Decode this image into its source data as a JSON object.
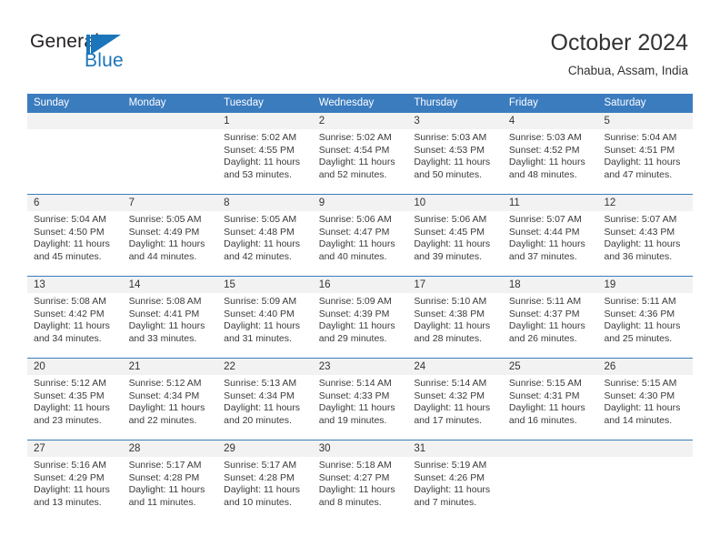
{
  "brand": {
    "name_top": "General",
    "name_bottom": "Blue",
    "accent_color": "#1b75bb"
  },
  "header": {
    "month_title": "October 2024",
    "location": "Chabua, Assam, India"
  },
  "theme": {
    "header_blue": "#3b7cbf",
    "daynum_band": "#f2f2f2",
    "text": "#333333"
  },
  "calendar": {
    "weekdays": [
      "Sunday",
      "Monday",
      "Tuesday",
      "Wednesday",
      "Thursday",
      "Friday",
      "Saturday"
    ],
    "labels": {
      "sunrise": "Sunrise:",
      "sunset": "Sunset:",
      "daylight": "Daylight:"
    },
    "weeks": [
      [
        {
          "day": "",
          "line1": "",
          "line2": "",
          "line3": "",
          "line4": ""
        },
        {
          "day": "",
          "line1": "",
          "line2": "",
          "line3": "",
          "line4": ""
        },
        {
          "day": "1",
          "line1": "Sunrise: 5:02 AM",
          "line2": "Sunset: 4:55 PM",
          "line3": "Daylight: 11 hours",
          "line4": "and 53 minutes."
        },
        {
          "day": "2",
          "line1": "Sunrise: 5:02 AM",
          "line2": "Sunset: 4:54 PM",
          "line3": "Daylight: 11 hours",
          "line4": "and 52 minutes."
        },
        {
          "day": "3",
          "line1": "Sunrise: 5:03 AM",
          "line2": "Sunset: 4:53 PM",
          "line3": "Daylight: 11 hours",
          "line4": "and 50 minutes."
        },
        {
          "day": "4",
          "line1": "Sunrise: 5:03 AM",
          "line2": "Sunset: 4:52 PM",
          "line3": "Daylight: 11 hours",
          "line4": "and 48 minutes."
        },
        {
          "day": "5",
          "line1": "Sunrise: 5:04 AM",
          "line2": "Sunset: 4:51 PM",
          "line3": "Daylight: 11 hours",
          "line4": "and 47 minutes."
        }
      ],
      [
        {
          "day": "6",
          "line1": "Sunrise: 5:04 AM",
          "line2": "Sunset: 4:50 PM",
          "line3": "Daylight: 11 hours",
          "line4": "and 45 minutes."
        },
        {
          "day": "7",
          "line1": "Sunrise: 5:05 AM",
          "line2": "Sunset: 4:49 PM",
          "line3": "Daylight: 11 hours",
          "line4": "and 44 minutes."
        },
        {
          "day": "8",
          "line1": "Sunrise: 5:05 AM",
          "line2": "Sunset: 4:48 PM",
          "line3": "Daylight: 11 hours",
          "line4": "and 42 minutes."
        },
        {
          "day": "9",
          "line1": "Sunrise: 5:06 AM",
          "line2": "Sunset: 4:47 PM",
          "line3": "Daylight: 11 hours",
          "line4": "and 40 minutes."
        },
        {
          "day": "10",
          "line1": "Sunrise: 5:06 AM",
          "line2": "Sunset: 4:45 PM",
          "line3": "Daylight: 11 hours",
          "line4": "and 39 minutes."
        },
        {
          "day": "11",
          "line1": "Sunrise: 5:07 AM",
          "line2": "Sunset: 4:44 PM",
          "line3": "Daylight: 11 hours",
          "line4": "and 37 minutes."
        },
        {
          "day": "12",
          "line1": "Sunrise: 5:07 AM",
          "line2": "Sunset: 4:43 PM",
          "line3": "Daylight: 11 hours",
          "line4": "and 36 minutes."
        }
      ],
      [
        {
          "day": "13",
          "line1": "Sunrise: 5:08 AM",
          "line2": "Sunset: 4:42 PM",
          "line3": "Daylight: 11 hours",
          "line4": "and 34 minutes."
        },
        {
          "day": "14",
          "line1": "Sunrise: 5:08 AM",
          "line2": "Sunset: 4:41 PM",
          "line3": "Daylight: 11 hours",
          "line4": "and 33 minutes."
        },
        {
          "day": "15",
          "line1": "Sunrise: 5:09 AM",
          "line2": "Sunset: 4:40 PM",
          "line3": "Daylight: 11 hours",
          "line4": "and 31 minutes."
        },
        {
          "day": "16",
          "line1": "Sunrise: 5:09 AM",
          "line2": "Sunset: 4:39 PM",
          "line3": "Daylight: 11 hours",
          "line4": "and 29 minutes."
        },
        {
          "day": "17",
          "line1": "Sunrise: 5:10 AM",
          "line2": "Sunset: 4:38 PM",
          "line3": "Daylight: 11 hours",
          "line4": "and 28 minutes."
        },
        {
          "day": "18",
          "line1": "Sunrise: 5:11 AM",
          "line2": "Sunset: 4:37 PM",
          "line3": "Daylight: 11 hours",
          "line4": "and 26 minutes."
        },
        {
          "day": "19",
          "line1": "Sunrise: 5:11 AM",
          "line2": "Sunset: 4:36 PM",
          "line3": "Daylight: 11 hours",
          "line4": "and 25 minutes."
        }
      ],
      [
        {
          "day": "20",
          "line1": "Sunrise: 5:12 AM",
          "line2": "Sunset: 4:35 PM",
          "line3": "Daylight: 11 hours",
          "line4": "and 23 minutes."
        },
        {
          "day": "21",
          "line1": "Sunrise: 5:12 AM",
          "line2": "Sunset: 4:34 PM",
          "line3": "Daylight: 11 hours",
          "line4": "and 22 minutes."
        },
        {
          "day": "22",
          "line1": "Sunrise: 5:13 AM",
          "line2": "Sunset: 4:34 PM",
          "line3": "Daylight: 11 hours",
          "line4": "and 20 minutes."
        },
        {
          "day": "23",
          "line1": "Sunrise: 5:14 AM",
          "line2": "Sunset: 4:33 PM",
          "line3": "Daylight: 11 hours",
          "line4": "and 19 minutes."
        },
        {
          "day": "24",
          "line1": "Sunrise: 5:14 AM",
          "line2": "Sunset: 4:32 PM",
          "line3": "Daylight: 11 hours",
          "line4": "and 17 minutes."
        },
        {
          "day": "25",
          "line1": "Sunrise: 5:15 AM",
          "line2": "Sunset: 4:31 PM",
          "line3": "Daylight: 11 hours",
          "line4": "and 16 minutes."
        },
        {
          "day": "26",
          "line1": "Sunrise: 5:15 AM",
          "line2": "Sunset: 4:30 PM",
          "line3": "Daylight: 11 hours",
          "line4": "and 14 minutes."
        }
      ],
      [
        {
          "day": "27",
          "line1": "Sunrise: 5:16 AM",
          "line2": "Sunset: 4:29 PM",
          "line3": "Daylight: 11 hours",
          "line4": "and 13 minutes."
        },
        {
          "day": "28",
          "line1": "Sunrise: 5:17 AM",
          "line2": "Sunset: 4:28 PM",
          "line3": "Daylight: 11 hours",
          "line4": "and 11 minutes."
        },
        {
          "day": "29",
          "line1": "Sunrise: 5:17 AM",
          "line2": "Sunset: 4:28 PM",
          "line3": "Daylight: 11 hours",
          "line4": "and 10 minutes."
        },
        {
          "day": "30",
          "line1": "Sunrise: 5:18 AM",
          "line2": "Sunset: 4:27 PM",
          "line3": "Daylight: 11 hours",
          "line4": "and 8 minutes."
        },
        {
          "day": "31",
          "line1": "Sunrise: 5:19 AM",
          "line2": "Sunset: 4:26 PM",
          "line3": "Daylight: 11 hours",
          "line4": "and 7 minutes."
        },
        {
          "day": "",
          "line1": "",
          "line2": "",
          "line3": "",
          "line4": ""
        },
        {
          "day": "",
          "line1": "",
          "line2": "",
          "line3": "",
          "line4": ""
        }
      ]
    ]
  }
}
